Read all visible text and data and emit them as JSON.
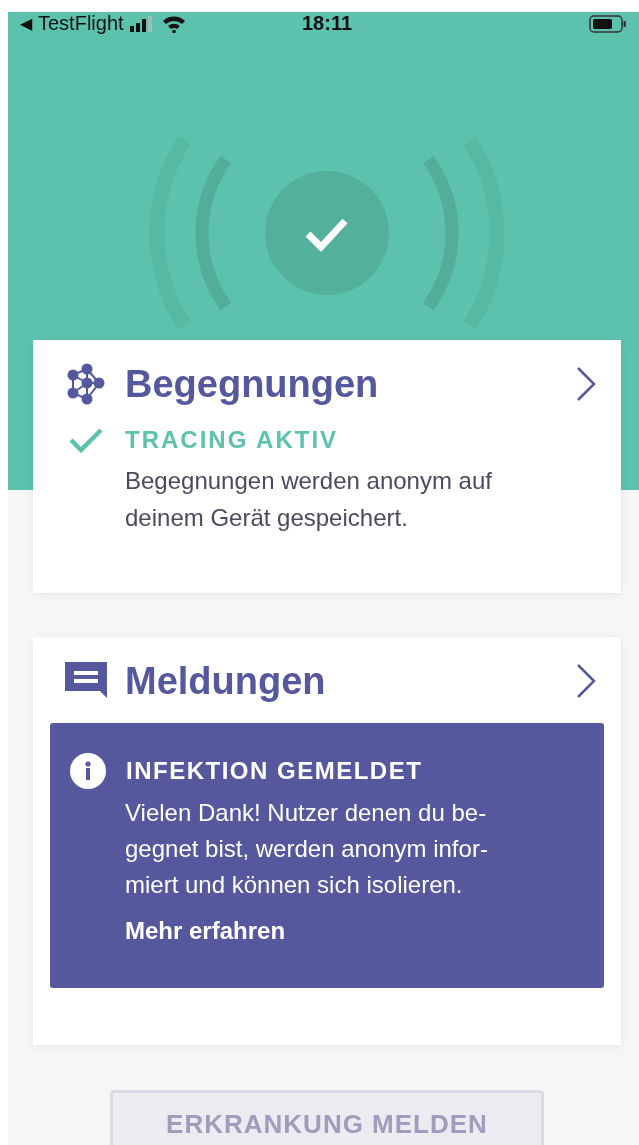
{
  "status_bar": {
    "back_arrow": "◀",
    "back_label": "TestFlight",
    "time": "18:11"
  },
  "hero": {
    "tracing_active": true
  },
  "cards": [
    {
      "kind": "encounters",
      "title": "Begegnungen",
      "status": {
        "label": "TRACING AKTIV",
        "active": true
      },
      "description_lines": [
        "Begegnungen werden anonym auf",
        "deinem Gerät gespeichert."
      ]
    },
    {
      "kind": "messages",
      "title": "Meldungen",
      "notice": {
        "title": "INFEKTION GEMELDET",
        "text_lines": [
          "Vielen Dank! Nutzer denen du be-",
          "gegnet bist, werden anonym infor-",
          "miert und können sich isolieren."
        ],
        "link": "Mehr erfahren"
      }
    }
  ],
  "report_button": {
    "label": "ERKRANKUNG MELDEN",
    "disabled": true
  }
}
